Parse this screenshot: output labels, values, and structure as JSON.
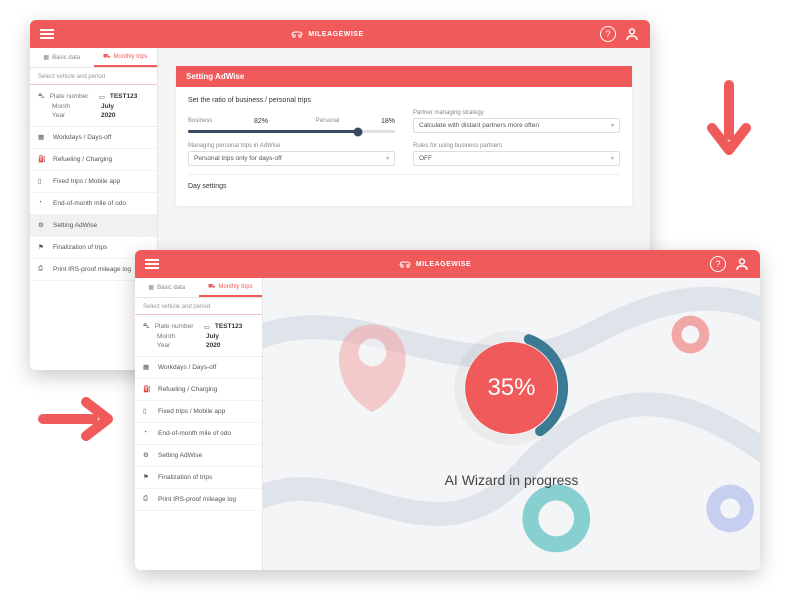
{
  "colors": {
    "accent": "#f05a5a",
    "ring": "#3a7b93"
  },
  "brand": "MILEAGEWISE",
  "tabs": {
    "basic": "Basic data",
    "monthly": "Monthly trips"
  },
  "sidebar": {
    "select_header": "Select vehicle and period",
    "plate_label": "Plate number",
    "plate_value": "TEST123",
    "month_label": "Month",
    "month_value": "July",
    "year_label": "Year",
    "year_value": "2020",
    "items": [
      "Workdays / Days-off",
      "Refueling / Charging",
      "Fixed trips / Mobile app",
      "End-of-month mile of odo",
      "Setting AdWise",
      "Finalization of trips",
      "Print IRS-proof mileage log"
    ]
  },
  "panel": {
    "title": "Setting AdWise",
    "section1_title": "Set the ratio of business / personal trips",
    "business_label": "Business",
    "business_pct": "82%",
    "personal_label": "Personal",
    "personal_pct": "18%",
    "partner_strategy_label": "Partner managing strategy",
    "partner_strategy_value": "Calculate with distant partners more often",
    "manage_personal_label": "Managing personal trips in AdWise",
    "manage_personal_value": "Personal trips only for days-off",
    "rules_label": "Rules for using business partners",
    "rules_value": "OFF",
    "section2_title": "Day settings"
  },
  "progress": {
    "percent_text": "35%",
    "percent": 35,
    "label": "AI Wizard in progress"
  }
}
